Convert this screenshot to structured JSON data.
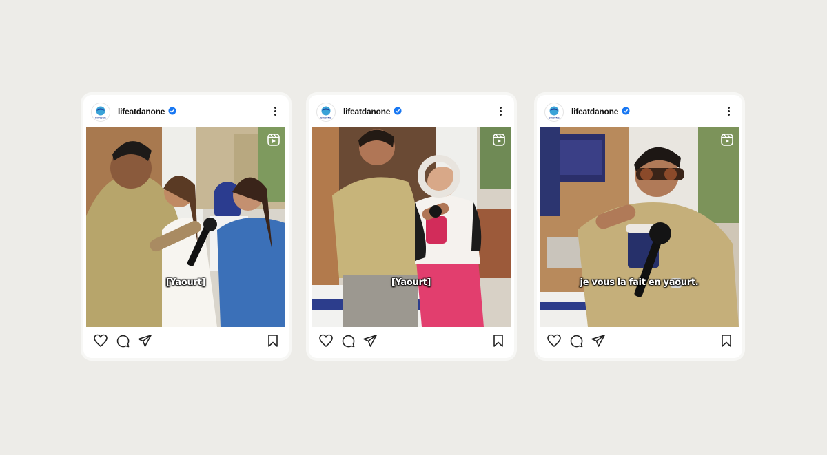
{
  "posts": [
    {
      "username": "lifeatdanone",
      "avatar_label": "DANONE",
      "caption": "[Yaourt]",
      "media_type_icon": "reels-icon"
    },
    {
      "username": "lifeatdanone",
      "avatar_label": "DANONE",
      "caption": "[Yaourt]",
      "media_type_icon": "reels-icon"
    },
    {
      "username": "lifeatdanone",
      "avatar_label": "DANONE",
      "caption": "je vous la fait en yaourt.",
      "media_type_icon": "reels-icon"
    }
  ],
  "icons": {
    "verified": "verified-badge-icon",
    "more": "more-options-icon",
    "like": "heart-icon",
    "comment": "comment-icon",
    "share": "send-icon",
    "save": "bookmark-icon"
  },
  "colors": {
    "background": "#edece8",
    "card": "#ffffff",
    "verified_blue": "#1877f2",
    "brand_blue": "#1e3c96"
  }
}
